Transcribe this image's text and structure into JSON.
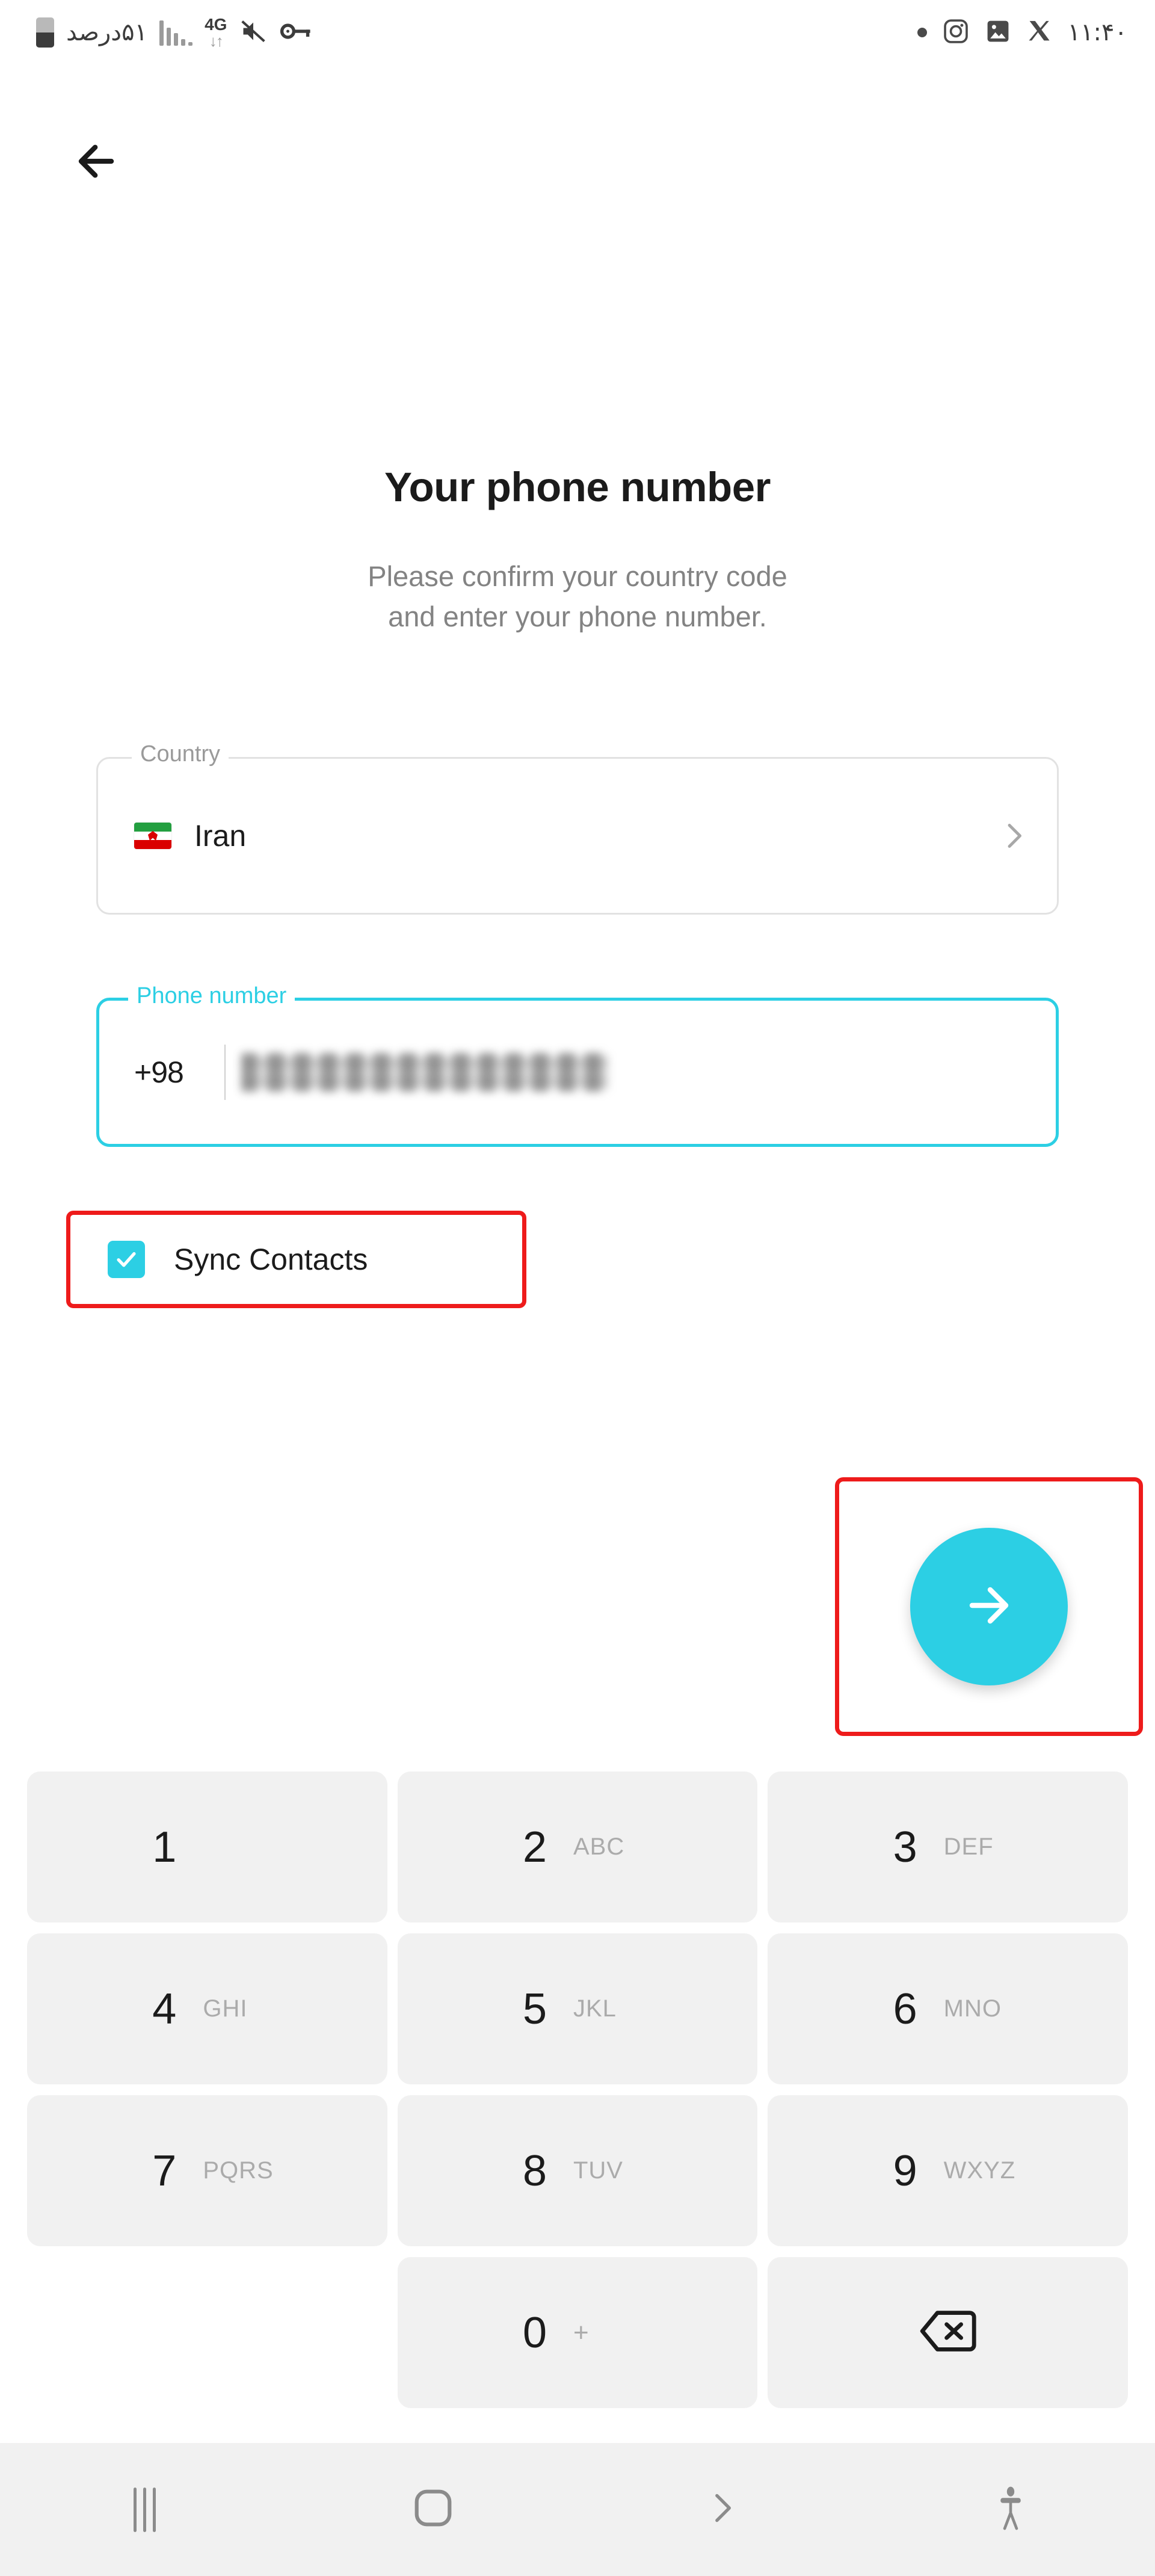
{
  "status_bar": {
    "battery_text": "۵۱درصد",
    "network_type": "4G",
    "icons_left": [
      "battery-icon",
      "signal-bars-icon",
      "4g-data-icon",
      "mute-icon",
      "vpn-key-icon"
    ],
    "icons_right": [
      "notification-dot-icon",
      "instagram-icon",
      "gallery-icon",
      "x-twitter-icon"
    ],
    "time": "۱۱:۴۰"
  },
  "topbar": {
    "back_icon": "arrow-left-icon"
  },
  "header": {
    "title": "Your phone number",
    "subtitle_line1": "Please confirm your country code",
    "subtitle_line2": "and enter your phone number."
  },
  "country_field": {
    "label": "Country",
    "value": "Iran",
    "flag": "iran-flag",
    "chevron": "chevron-right-icon"
  },
  "phone_field": {
    "label": "Phone number",
    "country_code": "+98",
    "value": "",
    "placeholder": "",
    "redacted": true,
    "focused": true
  },
  "sync_contacts": {
    "label": "Sync Contacts",
    "checked": true,
    "highlighted": true
  },
  "next_button": {
    "icon": "arrow-right-icon",
    "highlighted": true
  },
  "keypad": {
    "keys": [
      {
        "digit": "1",
        "letters": ""
      },
      {
        "digit": "2",
        "letters": "ABC"
      },
      {
        "digit": "3",
        "letters": "DEF"
      },
      {
        "digit": "4",
        "letters": "GHI"
      },
      {
        "digit": "5",
        "letters": "JKL"
      },
      {
        "digit": "6",
        "letters": "MNO"
      },
      {
        "digit": "7",
        "letters": "PQRS"
      },
      {
        "digit": "8",
        "letters": "TUV"
      },
      {
        "digit": "9",
        "letters": "WXYZ"
      },
      {
        "digit": "0",
        "letters": "+"
      }
    ],
    "backspace_icon": "backspace-icon"
  },
  "navbar": {
    "items": [
      {
        "name": "recents-button",
        "icon": "recents-icon"
      },
      {
        "name": "home-button",
        "icon": "home-icon"
      },
      {
        "name": "back-button",
        "icon": "chevron-right-icon"
      },
      {
        "name": "accessibility-button",
        "icon": "accessibility-icon"
      }
    ]
  },
  "colors": {
    "accent": "#2CCFE4",
    "highlight": "#EE1B1B",
    "key_bg": "#F1F1F1",
    "text_primary": "#1B1B1B",
    "text_secondary": "#838383"
  }
}
